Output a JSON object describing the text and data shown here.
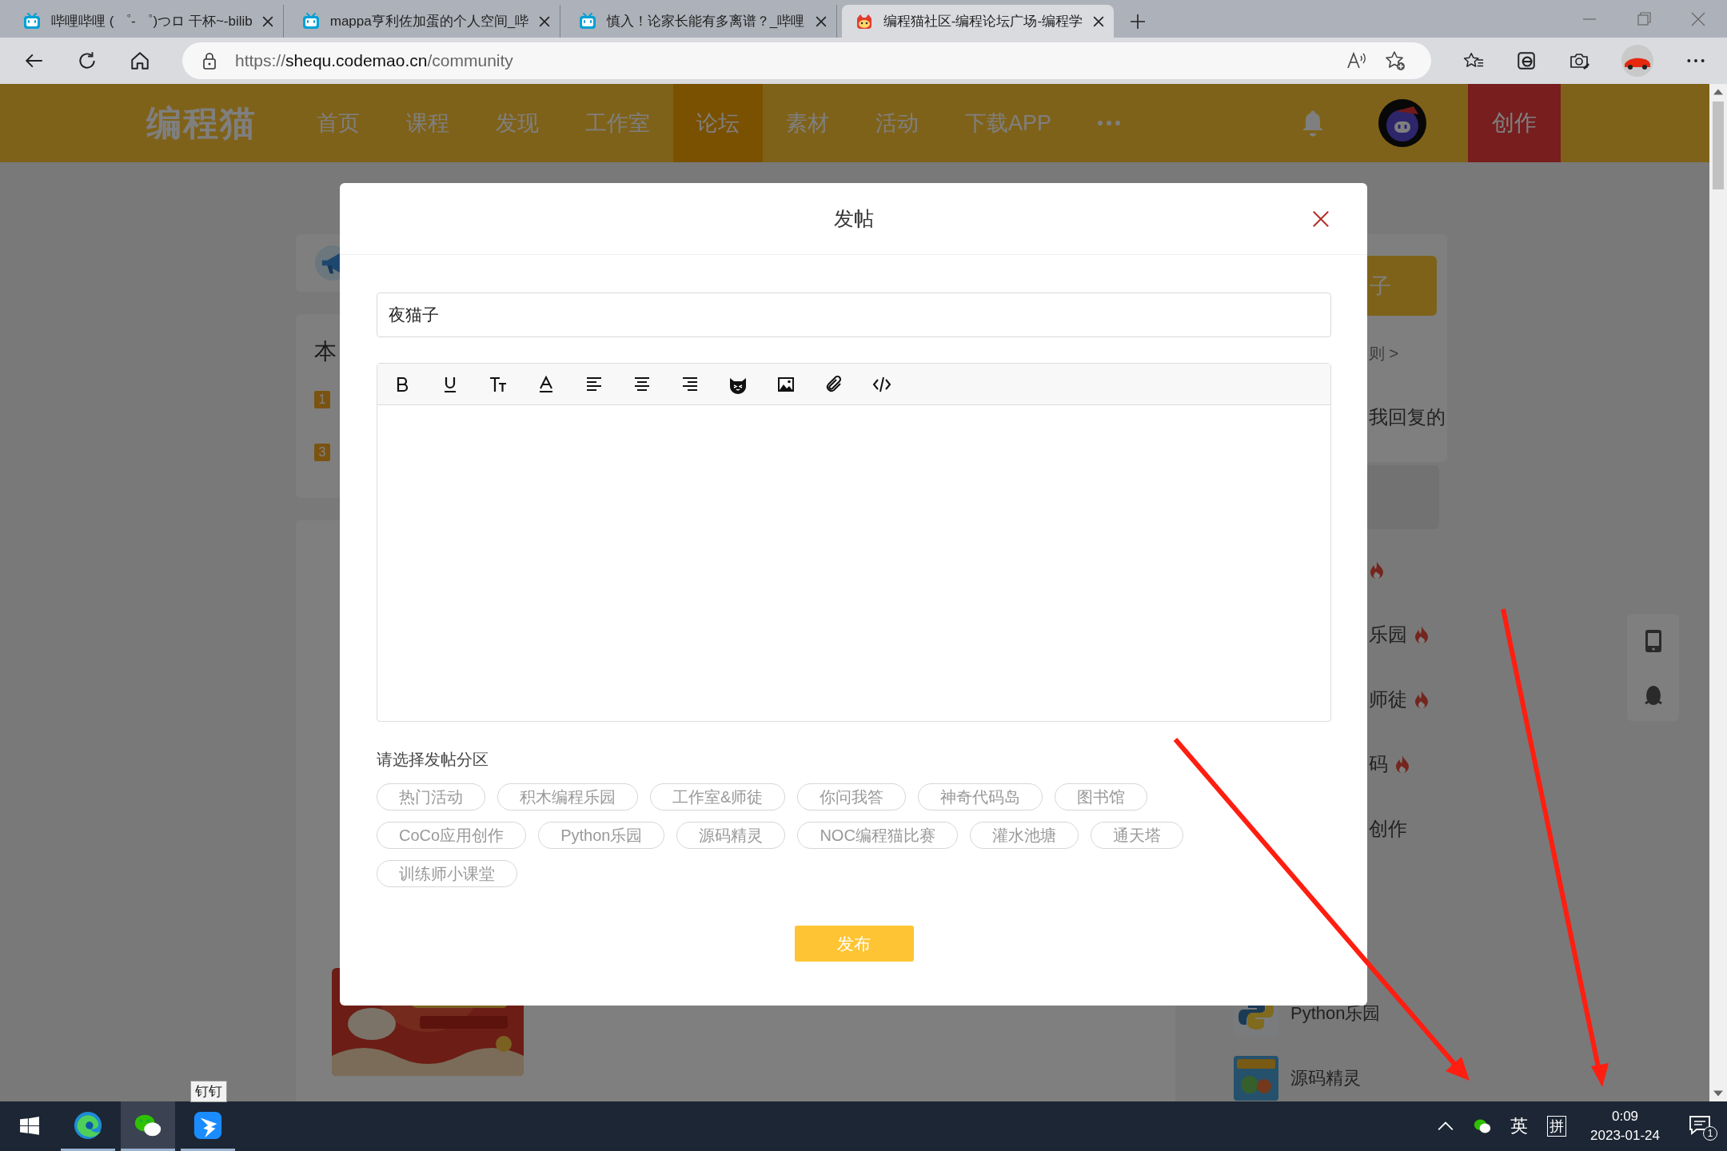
{
  "browser": {
    "tabs": [
      {
        "title": "哔哩哔哩 ( ゜- ゜)つロ 干杯~-bilib",
        "kind": "bilibili",
        "selected": false
      },
      {
        "title": "mappa亨利佐加蛋的个人空间_哔",
        "kind": "bilibili",
        "selected": false
      },
      {
        "title": "慎入！论家长能有多离谱？_哔哩",
        "kind": "bilibili",
        "selected": false
      },
      {
        "title": "编程猫社区-编程论坛广场-编程学",
        "kind": "codemao",
        "selected": true
      }
    ],
    "url": {
      "scheme": "https://",
      "host": "shequ.codemao.cn",
      "path": "/community"
    }
  },
  "site_nav": {
    "logo": "编程猫",
    "items": [
      {
        "label": "首页",
        "selected": false
      },
      {
        "label": "课程",
        "selected": false
      },
      {
        "label": "发现",
        "selected": false
      },
      {
        "label": "工作室",
        "selected": false
      },
      {
        "label": "论坛",
        "selected": true
      },
      {
        "label": "素材",
        "selected": false
      },
      {
        "label": "活动",
        "selected": false
      },
      {
        "label": "下载APP",
        "selected": false
      }
    ],
    "create_button": "创作"
  },
  "page_behind": {
    "left": {
      "heading": "本",
      "ranks": [
        "1",
        "3"
      ]
    },
    "right": {
      "post_button": "子",
      "rules_link": "则 >",
      "tab": "我回复的",
      "sections": [
        {
          "hot": true
        },
        {
          "label": "乐园",
          "hot": true
        },
        {
          "label": "师徒",
          "hot": true
        },
        {
          "label": "码",
          "hot": true
        },
        {
          "label": "创作",
          "hot": false
        }
      ],
      "boards": [
        {
          "name": "Python乐园",
          "kind": "python"
        },
        {
          "name": "源码精灵",
          "kind": "game"
        }
      ]
    }
  },
  "modal": {
    "title": "发帖",
    "title_field": {
      "value": "夜猫子"
    },
    "section_label": "请选择发帖分区",
    "categories": [
      {
        "label": "热门活动",
        "selected": false
      },
      {
        "label": "积木编程乐园",
        "selected": false
      },
      {
        "label": "工作室&师徒",
        "selected": false
      },
      {
        "label": "你问我答",
        "selected": false
      },
      {
        "label": "神奇代码岛",
        "selected": false
      },
      {
        "label": "图书馆",
        "selected": false
      },
      {
        "label": "CoCo应用创作",
        "selected": false
      },
      {
        "label": "Python乐园",
        "selected": false
      },
      {
        "label": "源码精灵",
        "selected": false
      },
      {
        "label": "NOC编程猫比赛",
        "selected": false
      },
      {
        "label": "灌水池塘",
        "selected": false
      },
      {
        "label": "通天塔",
        "selected": false
      },
      {
        "label": "训练师小课堂",
        "selected": false
      }
    ],
    "submit": "发布"
  },
  "taskbar": {
    "apps": [
      {
        "kind": "edge"
      },
      {
        "kind": "wechat"
      },
      {
        "kind": "dingtalk"
      }
    ],
    "tooltip": "钉钉",
    "ime": "英",
    "ime_mode": "拼",
    "time": "0:09",
    "date": "2023-01-24",
    "notifications": "1"
  }
}
